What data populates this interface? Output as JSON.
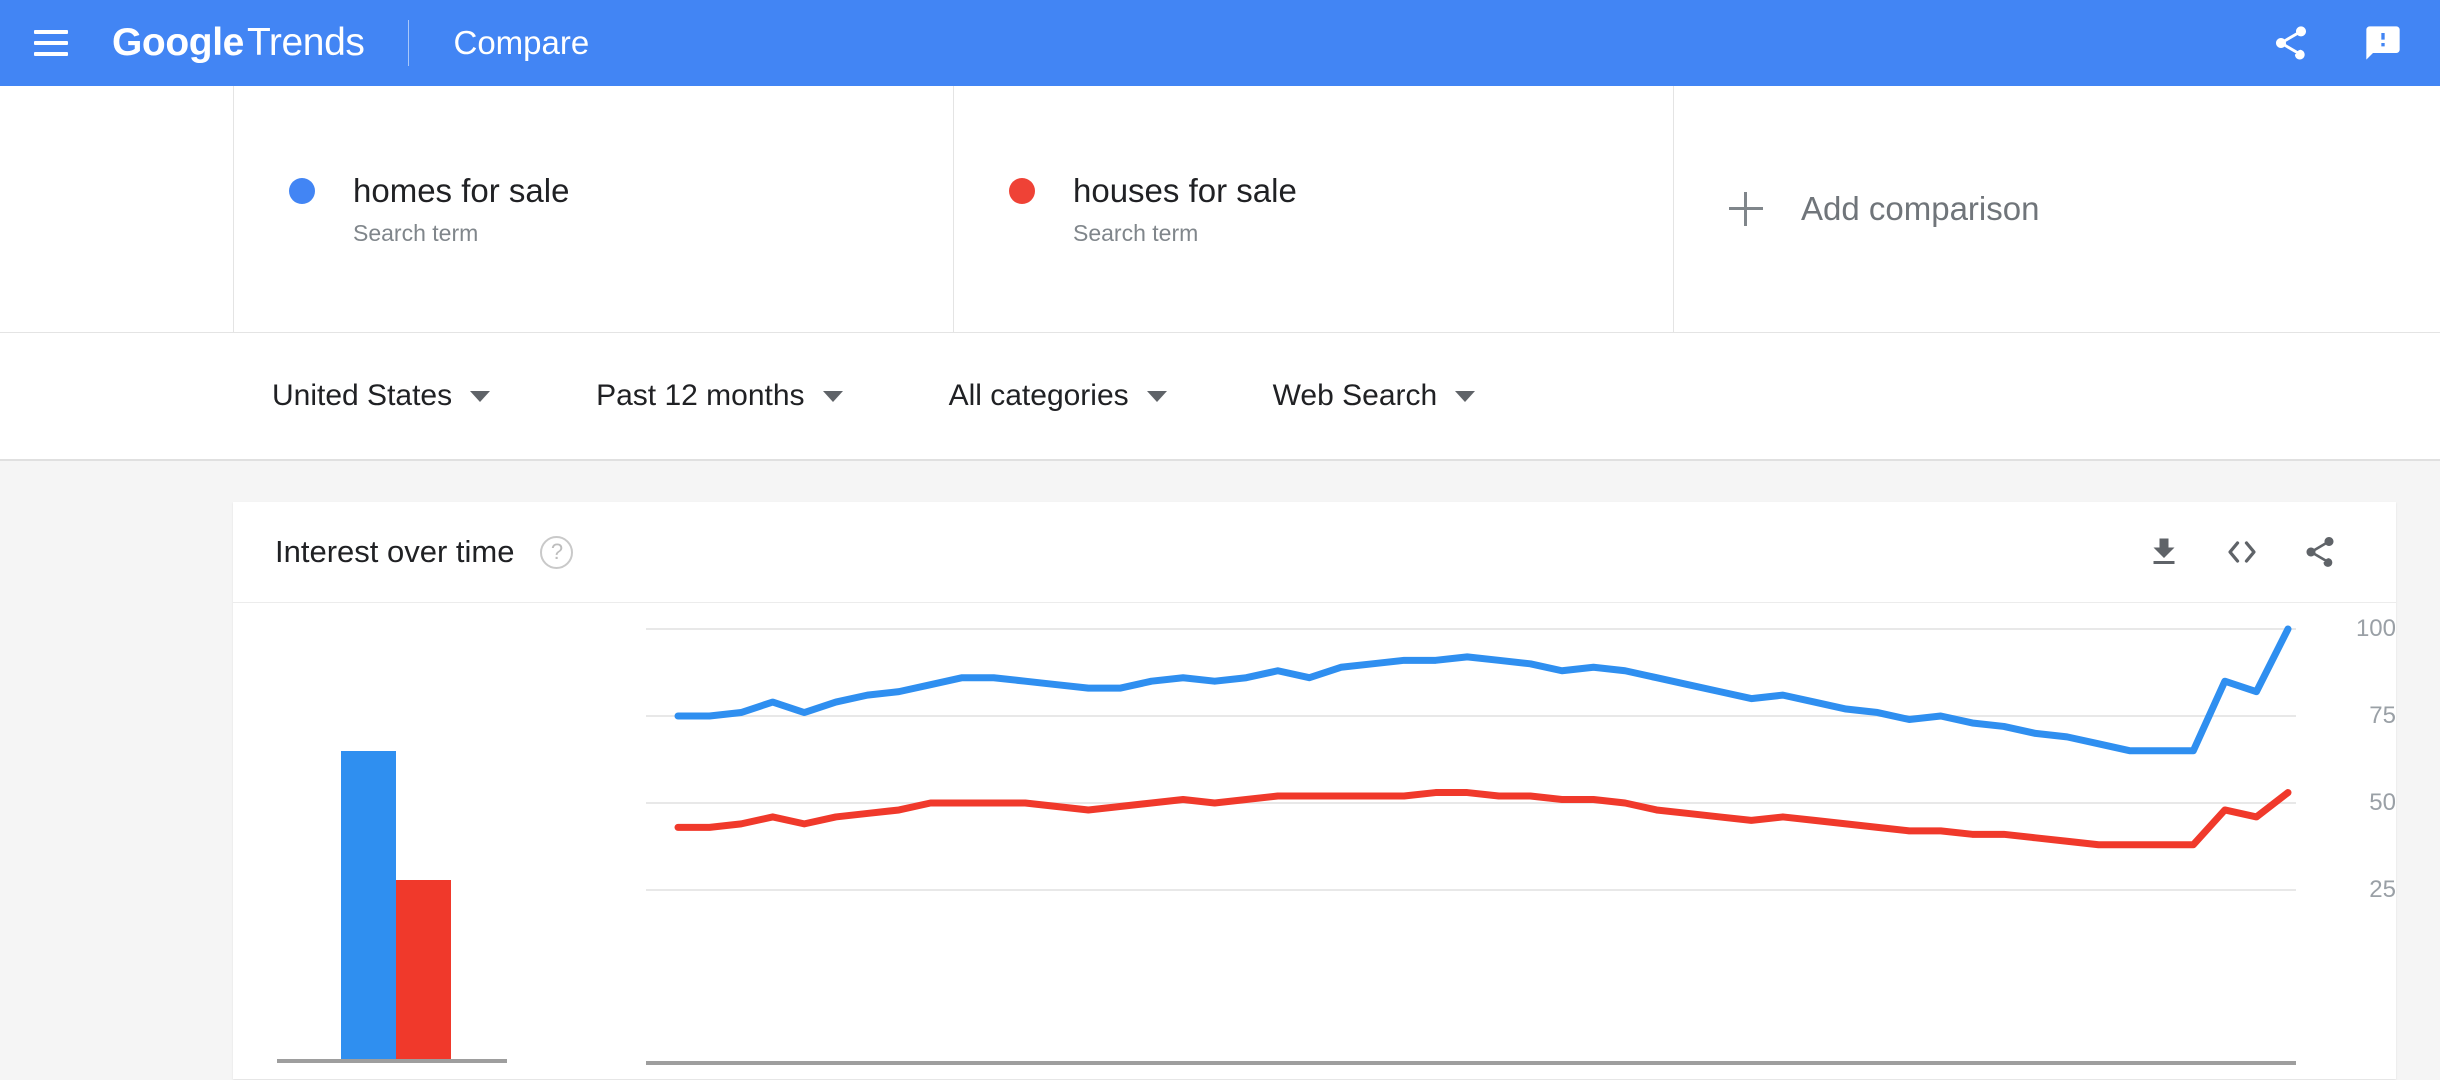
{
  "appbar": {
    "menu_icon": "hamburger-menu-icon",
    "brand_google": "Google",
    "brand_trends": "Trends",
    "section": "Compare",
    "share_icon": "share-icon",
    "feedback_icon": "feedback-icon"
  },
  "comparison": {
    "terms": [
      {
        "name": "homes for sale",
        "type": "Search term",
        "color": "#4285f4"
      },
      {
        "name": "houses for sale",
        "type": "Search term",
        "color": "#ef4236"
      }
    ],
    "add_label": "Add comparison",
    "add_icon": "plus-icon"
  },
  "filters": [
    {
      "label": "United States",
      "name": "region"
    },
    {
      "label": "Past 12 months",
      "name": "time-range"
    },
    {
      "label": "All categories",
      "name": "category"
    },
    {
      "label": "Web Search",
      "name": "search-type"
    }
  ],
  "card": {
    "title": "Interest over time",
    "help_icon": "help-icon",
    "help_glyph": "?",
    "download_icon": "download-icon",
    "embed_icon": "embed-code-icon",
    "share_icon": "share-icon"
  },
  "chart_data": {
    "type": "line",
    "title": "Interest over time",
    "xlabel": "",
    "ylabel": "",
    "ylim": [
      0,
      100
    ],
    "yticks": [
      100,
      75,
      50,
      25
    ],
    "grid": true,
    "legend_position": "top-cards",
    "x": [
      1,
      2,
      3,
      4,
      5,
      6,
      7,
      8,
      9,
      10,
      11,
      12,
      13,
      14,
      15,
      16,
      17,
      18,
      19,
      20,
      21,
      22,
      23,
      24,
      25,
      26,
      27,
      28,
      29,
      30,
      31,
      32,
      33,
      34,
      35,
      36,
      37,
      38,
      39,
      40,
      41,
      42,
      43,
      44,
      45,
      46,
      47,
      48,
      49,
      50,
      51,
      52
    ],
    "series": [
      {
        "name": "homes for sale",
        "color": "#2f8ff0",
        "values": [
          75,
          75,
          76,
          79,
          76,
          79,
          81,
          82,
          84,
          86,
          86,
          85,
          84,
          83,
          83,
          85,
          86,
          85,
          86,
          88,
          86,
          89,
          90,
          91,
          91,
          92,
          91,
          90,
          88,
          89,
          88,
          86,
          84,
          82,
          80,
          81,
          79,
          77,
          76,
          74,
          75,
          73,
          72,
          70,
          69,
          67,
          65,
          65,
          65,
          85,
          82,
          100
        ]
      },
      {
        "name": "houses for sale",
        "color": "#f0392b",
        "values": [
          43,
          43,
          44,
          46,
          44,
          46,
          47,
          48,
          50,
          50,
          50,
          50,
          49,
          48,
          49,
          50,
          51,
          50,
          51,
          52,
          52,
          52,
          52,
          52,
          53,
          53,
          52,
          52,
          51,
          51,
          50,
          48,
          47,
          46,
          45,
          46,
          45,
          44,
          43,
          42,
          42,
          41,
          41,
          40,
          39,
          38,
          38,
          38,
          38,
          48,
          46,
          53
        ]
      }
    ],
    "average_bars": {
      "type": "bar",
      "categories": [
        "homes for sale",
        "houses for sale"
      ],
      "values": [
        81,
        47
      ],
      "colors": [
        "#2f8ff0",
        "#f0392b"
      ]
    }
  }
}
